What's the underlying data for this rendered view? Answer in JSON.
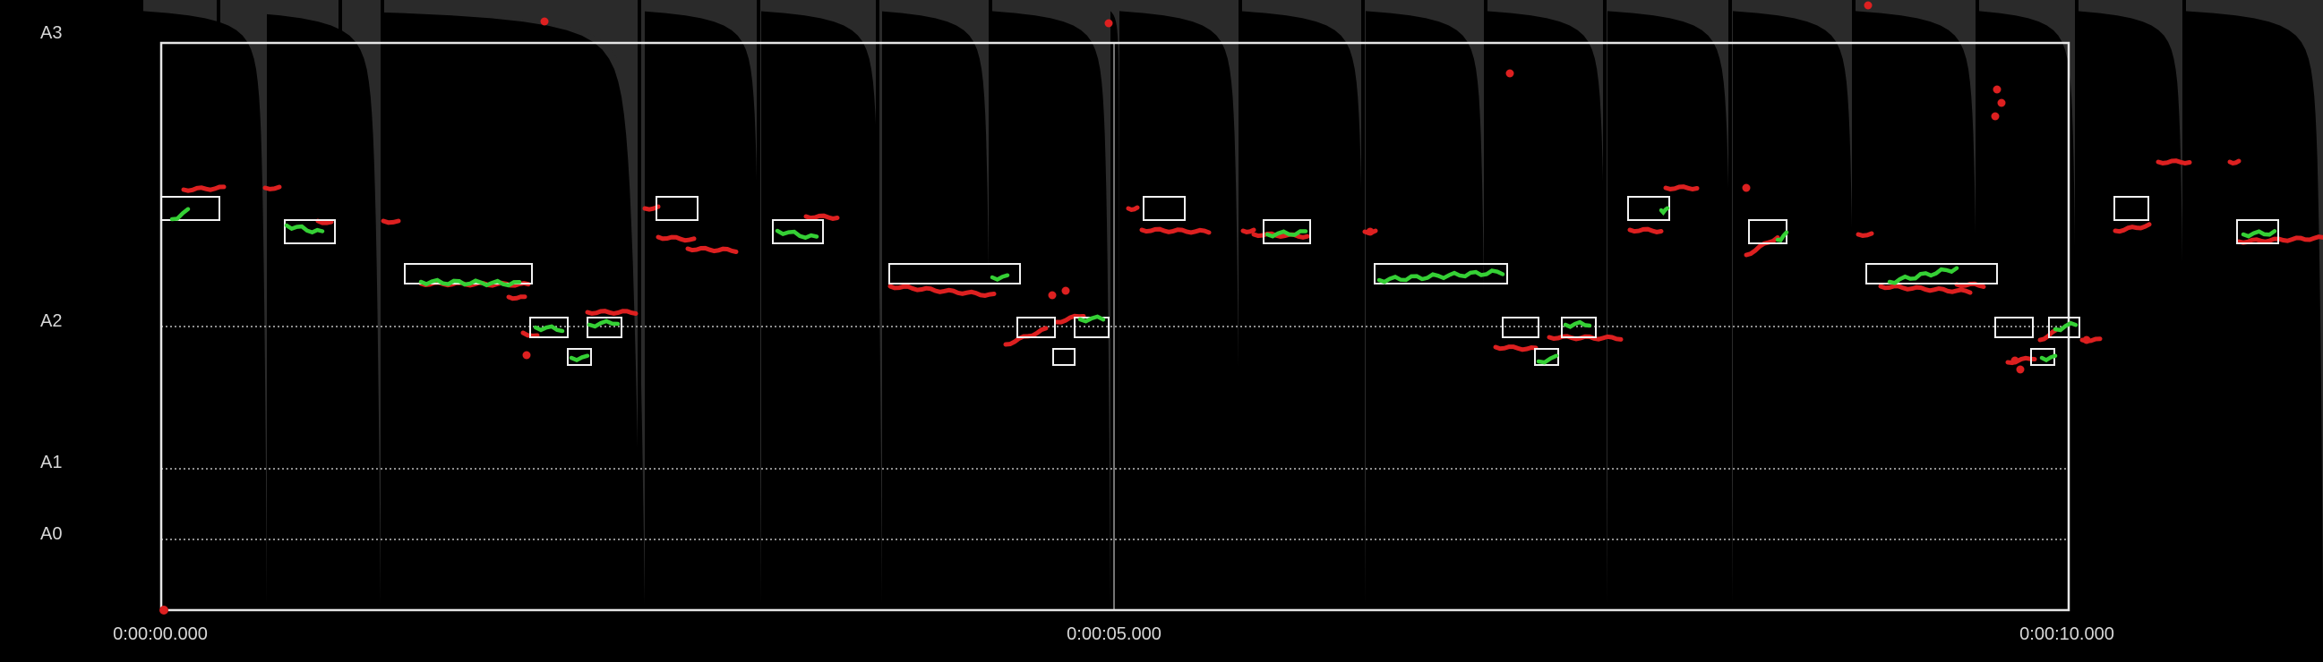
{
  "pitch_labels": [
    {
      "id": "a3",
      "text": "A3"
    },
    {
      "id": "a2",
      "text": "A2"
    },
    {
      "id": "a1",
      "text": "A1"
    },
    {
      "id": "a0",
      "text": "A0"
    }
  ],
  "time_labels": [
    {
      "id": "t0",
      "text": "0:00:00.000"
    },
    {
      "id": "t5",
      "text": "0:00:05.000"
    },
    {
      "id": "t10",
      "text": "0:00:10.000"
    }
  ],
  "colors": {
    "background": "#000000",
    "waveform": "#2a2a2a",
    "frame": "#e6e6e6",
    "grid": "#bdbdbd",
    "note_box": "#f2f2f2",
    "pitch_in_tune": "#35d035",
    "pitch_off": "#dd2020",
    "label_text": "#d8d8d8"
  },
  "icons": {
    "playhead": "vertical-cursor-line"
  }
}
